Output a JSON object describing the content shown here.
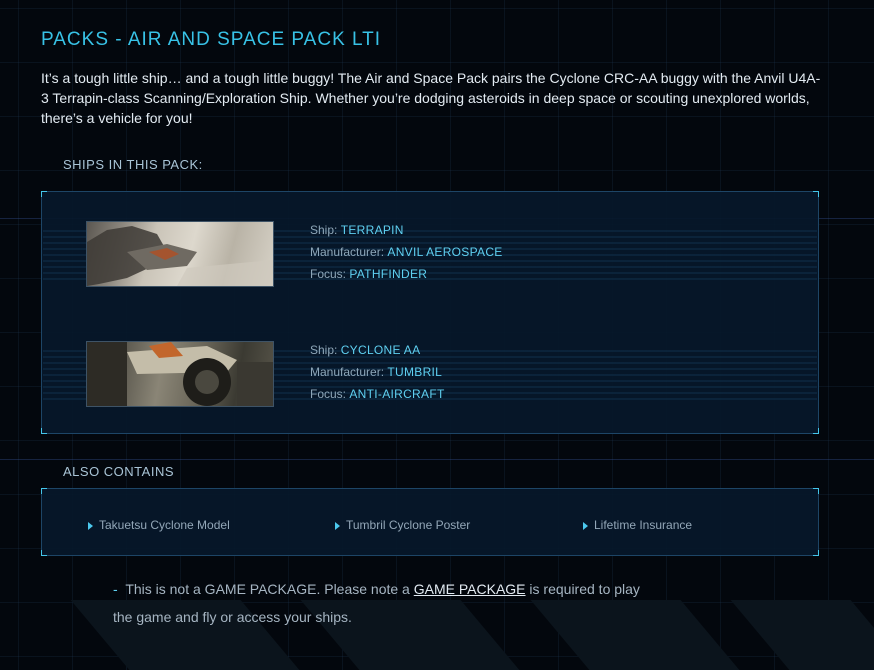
{
  "header": {
    "title": "PACKS - AIR AND SPACE PACK LTI",
    "description": "It’s a tough little ship… and a tough little buggy! The Air and Space Pack pairs the Cyclone CRC-AA buggy with the Anvil U4A-3 Terrapin-class Scanning/Exploration Ship. Whether you’re dodging asteroids in deep space or scouting unexplored worlds, there’s a vehicle for you!"
  },
  "ships_section": {
    "label": "SHIPS IN THIS PACK:",
    "ships": [
      {
        "ship_label": "Ship:",
        "ship": "TERRAPIN",
        "manufacturer_label": "Manufacturer:",
        "manufacturer": "ANVIL AEROSPACE",
        "focus_label": "Focus:",
        "focus": "PATHFINDER"
      },
      {
        "ship_label": "Ship:",
        "ship": "CYCLONE AA",
        "manufacturer_label": "Manufacturer:",
        "manufacturer": "TUMBRIL",
        "focus_label": "Focus:",
        "focus": "ANTI-AIRCRAFT"
      }
    ]
  },
  "contains_section": {
    "label": "ALSO CONTAINS",
    "items": [
      "Takuetsu Cyclone Model",
      "Tumbril Cyclone Poster",
      "Lifetime Insurance"
    ]
  },
  "note": {
    "dash": "-",
    "text_before": "This is not a GAME PACKAGE. Please note a",
    "link": "GAME PACKAGE",
    "text_after": "is required to play the game and fly or access your ships."
  },
  "colors": {
    "accent": "#38c2e6",
    "value": "#5fd0f1",
    "background": "#03070d",
    "panel_border": "#1d4566"
  }
}
